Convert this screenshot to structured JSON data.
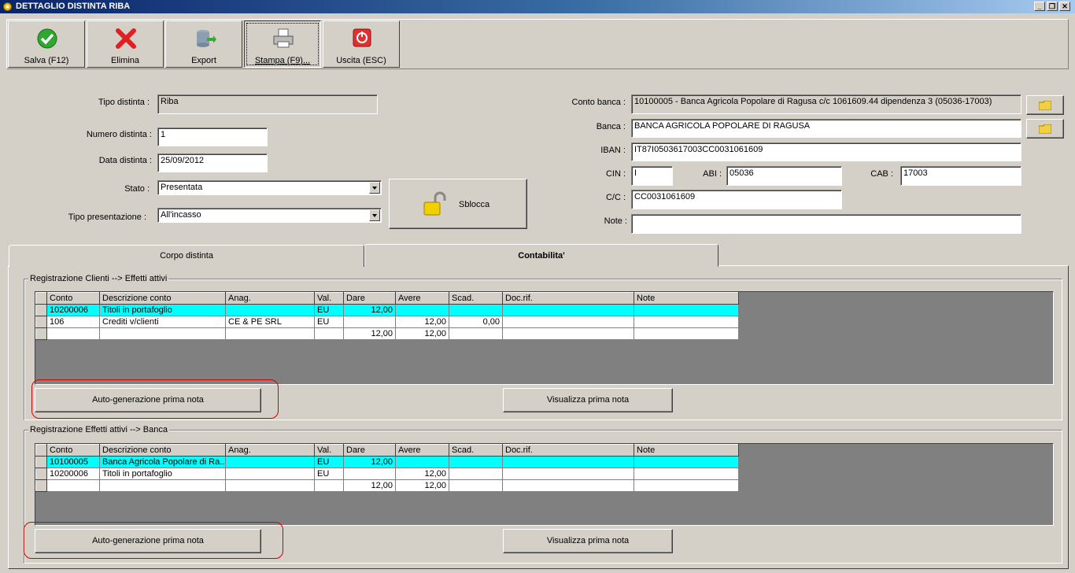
{
  "window": {
    "title": "DETTAGLIO DISTINTA RIBA"
  },
  "toolbar": {
    "save_label": "Salva (F12)",
    "delete_label": "Elimina",
    "export_label": "Export",
    "print_label": "Stampa (F9)...",
    "exit_label": "Uscita (ESC)"
  },
  "form": {
    "tipo_distinta_label": "Tipo distinta :",
    "tipo_distinta_value": "Riba",
    "numero_distinta_label": "Numero distinta :",
    "numero_distinta_value": "1",
    "data_distinta_label": "Data distinta :",
    "data_distinta_value": "25/09/2012",
    "stato_label": "Stato :",
    "stato_value": "Presentata",
    "tipo_presentazione_label": "Tipo presentazione :",
    "tipo_presentazione_value": "All'incasso",
    "sblocca_label": "Sblocca",
    "conto_banca_label": "Conto banca :",
    "conto_banca_value": "10100005 - Banca Agricola Popolare di Ragusa c/c 1061609.44 dipendenza 3 (05036-17003)",
    "banca_label": "Banca :",
    "banca_value": "BANCA AGRICOLA POPOLARE DI RAGUSA",
    "iban_label": "IBAN :",
    "iban_value": "IT87I0503617003CC0031061609",
    "cin_label": "CIN :",
    "cin_value": "I",
    "abi_label": "ABI :",
    "abi_value": "05036",
    "cab_label": "CAB :",
    "cab_value": "17003",
    "cc_label": "C/C :",
    "cc_value": "CC0031061609",
    "note_label": "Note :",
    "note_value": ""
  },
  "tabs": [
    {
      "label": "Corpo distinta"
    },
    {
      "label": "Contabilita'"
    }
  ],
  "grid_headers": [
    "Conto",
    "Descrizione conto",
    "Anag.",
    "Val.",
    "Dare",
    "Avere",
    "Scad.",
    "Doc.rif.",
    "Note"
  ],
  "section1": {
    "title": "Registrazione Clienti --> Effetti attivi",
    "rows": [
      [
        "10200006",
        "Titoli in portafoglio",
        "",
        "EU",
        "12,00",
        "",
        "",
        "",
        ""
      ],
      [
        "106",
        "Crediti v/clienti",
        "CE & PE SRL",
        "EU",
        "",
        "12,00",
        "0,00",
        "",
        ""
      ],
      [
        "",
        "",
        "",
        "",
        "12,00",
        "12,00",
        "",
        "",
        ""
      ]
    ],
    "auto_button": "Auto-generazione prima nota",
    "view_button": "Visualizza prima nota"
  },
  "section2": {
    "title": "Registrazione Effetti attivi --> Banca",
    "rows": [
      [
        "10100005",
        "Banca Agricola Popolare di Ra...",
        "",
        "EU",
        "12,00",
        "",
        "",
        "",
        ""
      ],
      [
        "10200006",
        "Titoli in portafoglio",
        "",
        "EU",
        "",
        "12,00",
        "",
        "",
        ""
      ],
      [
        "",
        "",
        "",
        "",
        "12,00",
        "12,00",
        "",
        "",
        ""
      ]
    ],
    "auto_button": "Auto-generazione prima nota",
    "view_button": "Visualizza prima nota"
  },
  "colors": {
    "selected_row": "#00ffff",
    "highlight": "#d40000",
    "title_bar": "#0a246a"
  }
}
